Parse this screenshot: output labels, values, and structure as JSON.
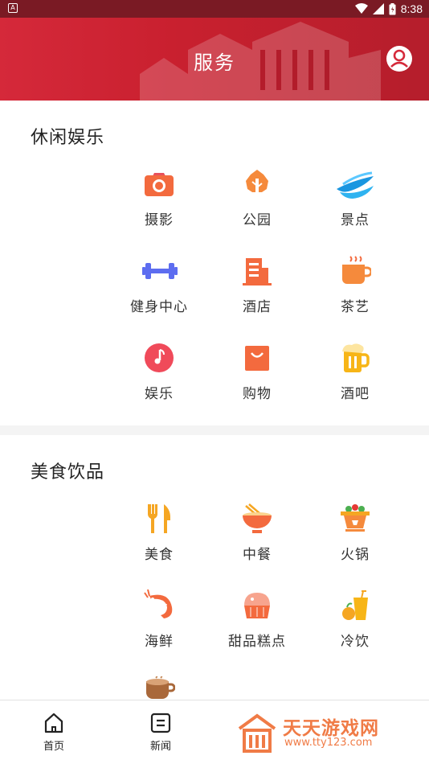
{
  "status_bar": {
    "time": "8:38"
  },
  "header": {
    "title": "服务",
    "user_icon": "user-icon"
  },
  "sections": [
    {
      "title": "休闲娱乐",
      "items": [
        {
          "label": "摄影",
          "icon": "camera-icon"
        },
        {
          "label": "公园",
          "icon": "tree-icon"
        },
        {
          "label": "景点",
          "icon": "wave-icon"
        },
        {
          "label": "健身中心",
          "icon": "dumbbell-icon"
        },
        {
          "label": "酒店",
          "icon": "hotel-icon"
        },
        {
          "label": "茶艺",
          "icon": "tea-cup-icon"
        },
        {
          "label": "娱乐",
          "icon": "music-note-icon"
        },
        {
          "label": "购物",
          "icon": "shopping-bag-icon"
        },
        {
          "label": "酒吧",
          "icon": "beer-mug-icon"
        }
      ]
    },
    {
      "title": "美食饮品",
      "items": [
        {
          "label": "美食",
          "icon": "fork-knife-icon"
        },
        {
          "label": "中餐",
          "icon": "noodle-bowl-icon"
        },
        {
          "label": "火锅",
          "icon": "hotpot-icon"
        },
        {
          "label": "海鲜",
          "icon": "shrimp-icon"
        },
        {
          "label": "甜品糕点",
          "icon": "cupcake-icon"
        },
        {
          "label": "冷饮",
          "icon": "juice-icon"
        },
        {
          "label": "",
          "icon": "coffee-icon"
        }
      ]
    }
  ],
  "bottom_nav": [
    {
      "label": "首页",
      "icon": "home-icon"
    },
    {
      "label": "新闻",
      "icon": "news-icon"
    }
  ],
  "watermark": {
    "title": "天天游戏网",
    "url": "www.tty123.com"
  },
  "colors": {
    "header": "#d5293a",
    "accent_orange": "#f36a3e",
    "yellow": "#f7b517"
  }
}
